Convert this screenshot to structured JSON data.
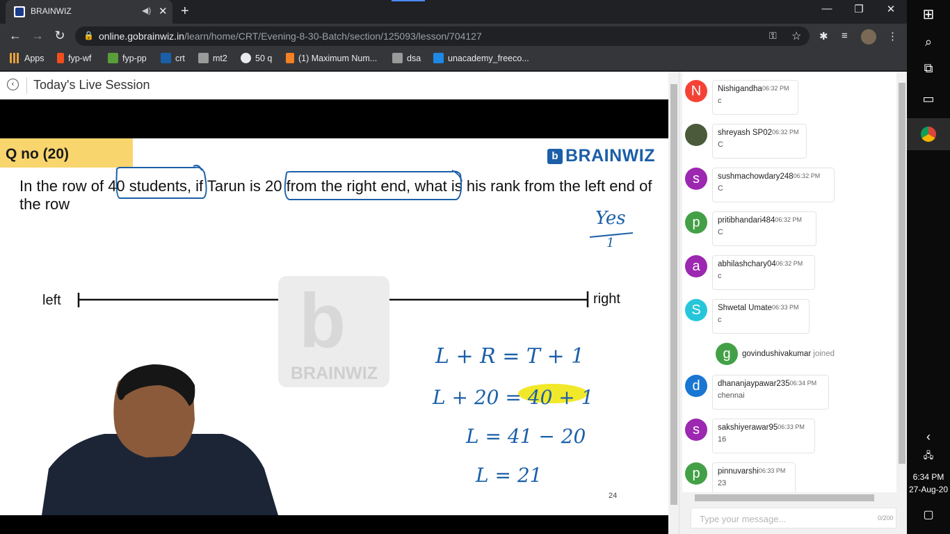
{
  "browser": {
    "tab_title": "BRAINWIZ",
    "url_host": "online.gobrainwiz.in",
    "url_path": "/learn/home/CRT/Evening-8-30-Batch/section/125093/lesson/704127",
    "bookmarks": [
      {
        "label": "Apps",
        "color": "#e8a33d"
      },
      {
        "label": "fyp-wf",
        "color": "#f24e1e"
      },
      {
        "label": "fyp-pp",
        "color": "#5a9e3a"
      },
      {
        "label": "crt",
        "color": "#1b5fa8"
      },
      {
        "label": "mt2",
        "color": "#9a9a9a"
      },
      {
        "label": "50 q",
        "color": "#e8eaed"
      },
      {
        "label": "(1) Maximum Num...",
        "color": "#f48024"
      },
      {
        "label": "dsa",
        "color": "#9a9a9a"
      },
      {
        "label": "unacademy_freeco...",
        "color": "#1e88e5"
      }
    ]
  },
  "page": {
    "title": "Today's Live Session",
    "slide": {
      "qno": "Q no (20)",
      "brand": "BRAINWIZ",
      "brand_letter": "b",
      "question_parts": [
        "In the row of ",
        "40 students",
        ", if Tarun is ",
        "20 from the right end,",
        " what is his rank from the left end of the row"
      ],
      "label_left": "left",
      "label_right": "right",
      "watermark": "BRAINWIZ",
      "handwriting": [
        "Yes",
        "1",
        "L + R = T + 1",
        "L + 20 = ",
        "40 + 1",
        "L = 41 − 20",
        "L = 21"
      ],
      "page_number": "24"
    }
  },
  "chat": {
    "messages": [
      {
        "initial": "N",
        "color": "#f44336",
        "name": "Nishigandha",
        "time": "06:32 PM",
        "text": "c",
        "w": 124
      },
      {
        "initial": "",
        "color": "#4a5a3a",
        "name": "shreyash SP02",
        "time": "06:32 PM",
        "text": "C",
        "w": 136
      },
      {
        "initial": "s",
        "color": "#9c27b0",
        "name": "sushmachowdary248",
        "time": "06:32 PM",
        "text": "C",
        "w": 176
      },
      {
        "initial": "p",
        "color": "#43a047",
        "name": "pritibhandari484",
        "time": "06:32 PM",
        "text": "C",
        "w": 150
      },
      {
        "initial": "a",
        "color": "#9c27b0",
        "name": "abhilashchary04",
        "time": "06:32 PM",
        "text": "c",
        "w": 148
      },
      {
        "initial": "S",
        "color": "#26c6da",
        "name": "Shwetal Umate",
        "time": "06:33 PM",
        "text": "c",
        "w": 140
      },
      {
        "initial": "d",
        "color": "#1976d2",
        "name": "dhananjaypawar235",
        "time": "06:34 PM",
        "text": "chennai",
        "w": 168
      },
      {
        "initial": "s",
        "color": "#9c27b0",
        "name": "sakshiyerawar95",
        "time": "06:33 PM",
        "text": "16",
        "w": 148
      },
      {
        "initial": "p",
        "color": "#43a047",
        "name": "pinnuvarshi",
        "time": "06:33 PM",
        "text": "23",
        "w": 120
      }
    ],
    "joined": {
      "initial": "g",
      "color": "#43a047",
      "name": "govindushivakumar",
      "status": "joined"
    },
    "input_placeholder": "Type your message...",
    "char_count": "0/200"
  },
  "taskbar": {
    "time": "6:34 PM",
    "date": "27-Aug-20"
  }
}
